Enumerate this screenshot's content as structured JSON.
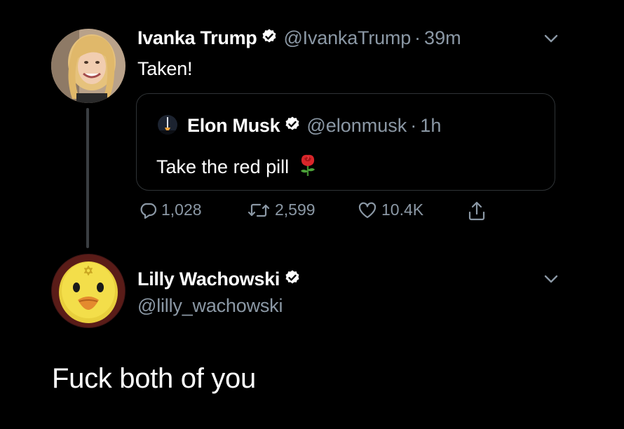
{
  "tweets": [
    {
      "author_name": "Ivanka Trump",
      "verified": true,
      "handle": "@IvankaTrump",
      "separator": "·",
      "time": "39m",
      "text": "Taken!",
      "avatar_icon": "profile-photo-woman",
      "menu_icon": "chevron-down-icon",
      "quoted_tweet": {
        "author_name": "Elon Musk",
        "verified": true,
        "handle": "@elonmusk",
        "separator": "·",
        "time": "1h",
        "text": "Take the red pill",
        "emoji_icon": "rose-icon",
        "avatar_icon": "rocket-launch-avatar"
      },
      "actions": {
        "reply_count": "1,028",
        "retweet_count": "2,599",
        "like_count": "10.4K",
        "share_icon": "share-icon"
      }
    },
    {
      "author_name": "Lilly Wachowski",
      "verified": true,
      "handle": "@lilly_wachowski",
      "avatar_icon": "yellow-duck-avatar",
      "menu_icon": "chevron-down-icon",
      "text": "Fuck both of you"
    }
  ],
  "colors": {
    "background": "#000000",
    "text_primary": "#ffffff",
    "text_secondary": "#8b98a5",
    "border": "#2f3336",
    "thread_line": "#3a3e42"
  }
}
